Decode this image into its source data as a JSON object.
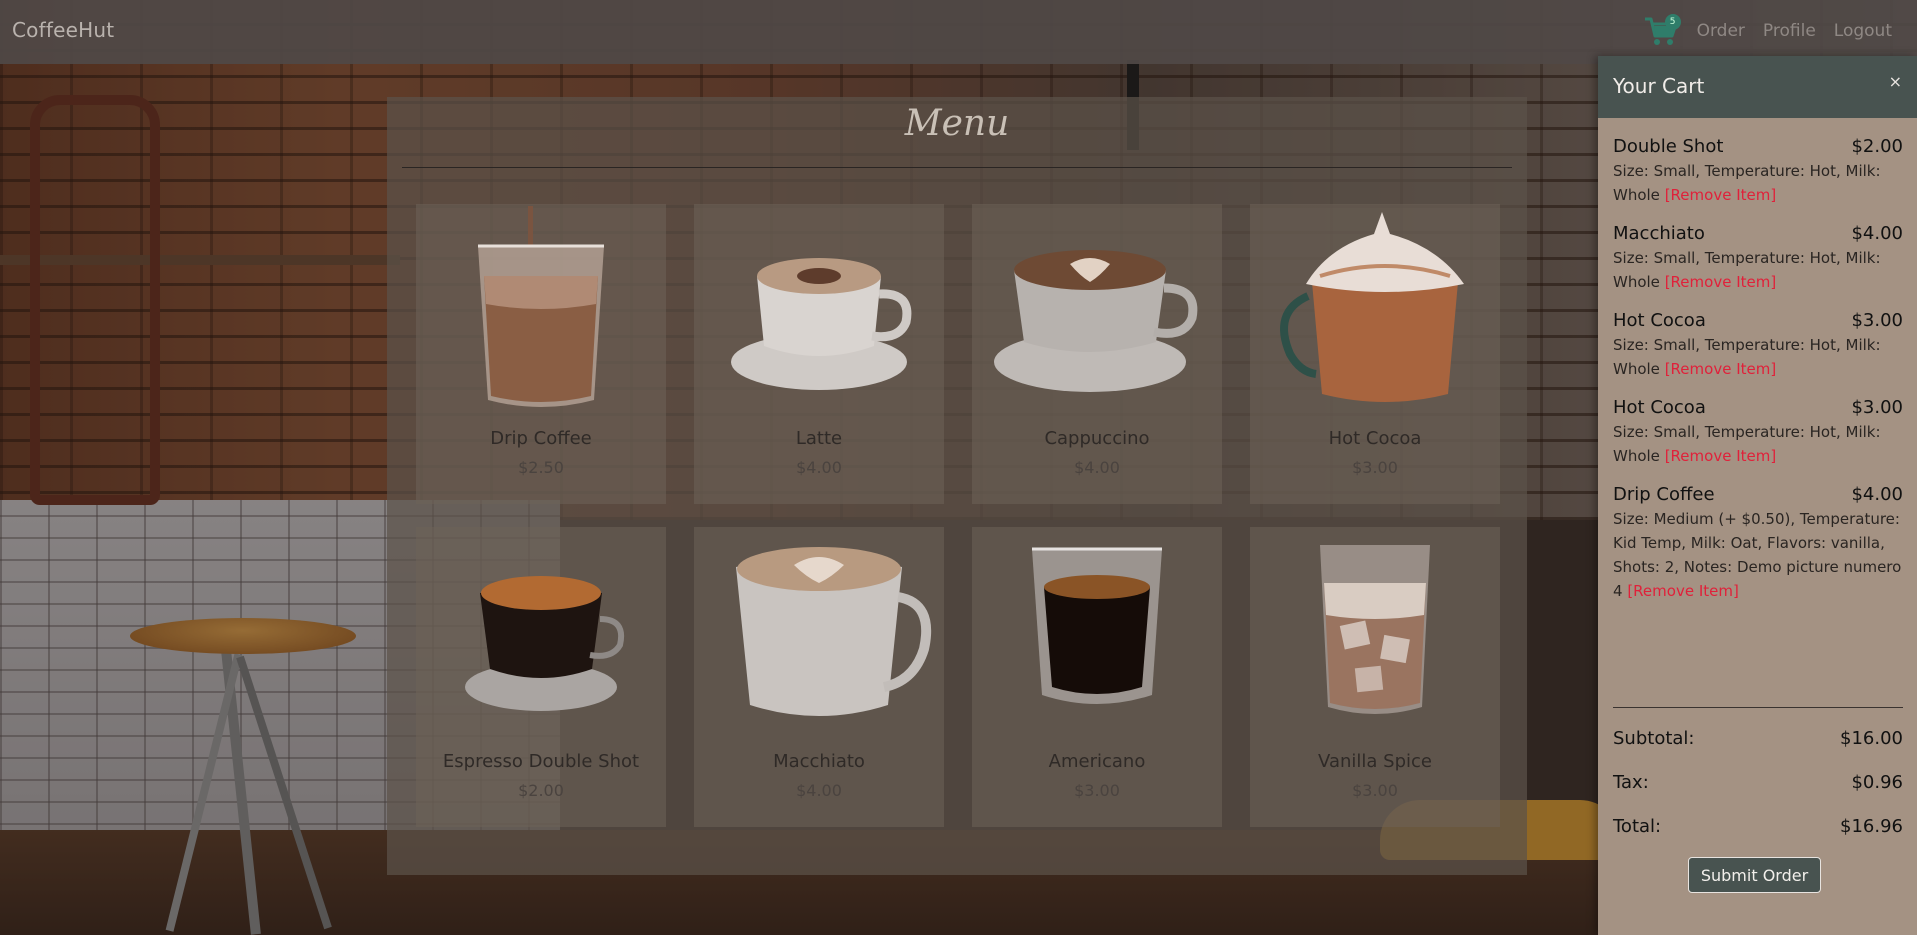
{
  "navbar": {
    "brand": "CoffeeHut",
    "cart_count": "5",
    "links": [
      "Order",
      "Profile",
      "Logout"
    ]
  },
  "menu": {
    "title": "Menu",
    "items": [
      {
        "name": "Drip Coffee",
        "price": "$2.50",
        "icon": "iced-coffee-glass"
      },
      {
        "name": "Latte",
        "price": "$4.00",
        "icon": "latte-cup"
      },
      {
        "name": "Cappuccino",
        "price": "$4.00",
        "icon": "cappuccino-cup"
      },
      {
        "name": "Hot Cocoa",
        "price": "$3.00",
        "icon": "hot-cocoa-mug"
      },
      {
        "name": "Espresso Double Shot",
        "price": "$2.00",
        "icon": "espresso-cup"
      },
      {
        "name": "Macchiato",
        "price": "$4.00",
        "icon": "macchiato-mug"
      },
      {
        "name": "Americano",
        "price": "$3.00",
        "icon": "americano-glass"
      },
      {
        "name": "Vanilla Spice",
        "price": "$3.00",
        "icon": "iced-latte-glass"
      }
    ]
  },
  "cart": {
    "title": "Your Cart",
    "close": "×",
    "remove_label": "[Remove Item]",
    "items": [
      {
        "name": "Double Shot",
        "price": "$2.00",
        "details": "Size: Small, Temperature: Hot, Milk: Whole"
      },
      {
        "name": "Macchiato",
        "price": "$4.00",
        "details": "Size: Small, Temperature: Hot, Milk: Whole"
      },
      {
        "name": "Hot Cocoa",
        "price": "$3.00",
        "details": "Size: Small, Temperature: Hot, Milk: Whole"
      },
      {
        "name": "Hot Cocoa",
        "price": "$3.00",
        "details": "Size: Small, Temperature: Hot, Milk: Whole"
      },
      {
        "name": "Drip Coffee",
        "price": "$4.00",
        "details": "Size: Medium (+ $0.50), Temperature: Kid Temp, Milk: Oat, Flavors: vanilla, Shots: 2, Notes: Demo picture numero 4"
      }
    ],
    "subtotal_label": "Subtotal:",
    "subtotal": "$16.00",
    "tax_label": "Tax:",
    "tax": "$0.96",
    "total_label": "Total:",
    "total": "$16.96",
    "submit_label": "Submit Order"
  },
  "colors": {
    "accent": "#2f7d6a",
    "cart_header": "#485350",
    "cart_bg": "#a49283",
    "remove": "#e0213a"
  }
}
